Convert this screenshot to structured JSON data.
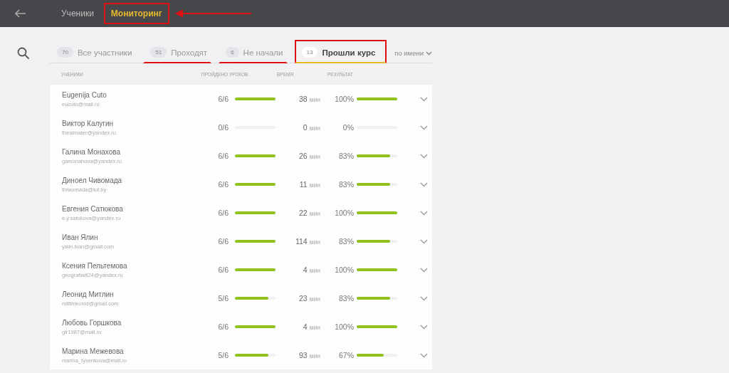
{
  "nav": [
    {
      "label": "Ученики",
      "selected": false,
      "framed": false
    },
    {
      "label": "Мониторинг",
      "selected": true,
      "framed": true
    }
  ],
  "filters": [
    {
      "count": "70",
      "label": "Все участники",
      "selected": false,
      "underlined": false,
      "framed": false
    },
    {
      "count": "51",
      "label": "Проходят",
      "selected": false,
      "underlined": true,
      "framed": false
    },
    {
      "count": "6",
      "label": "Не начали",
      "selected": false,
      "underlined": true,
      "framed": false
    },
    {
      "count": "13",
      "label": "Прошли курс",
      "selected": true,
      "underlined": false,
      "framed": true
    }
  ],
  "sort": {
    "label": "по имени"
  },
  "table": {
    "columns": [
      "УЧЕНИКИ",
      "ПРОЙДЕНО УРОКОВ",
      "ВРЕМЯ",
      "РЕЗУЛЬТАТ"
    ],
    "rows": [
      {
        "name": "Eugenija Cuto",
        "email": "eucuto@mail.ru",
        "lessons": "6/6",
        "lessons_progress": {
          "level": 1
        },
        "time": "38",
        "unit": "мин",
        "result": "100%",
        "result_progress": {
          "level": 1
        }
      },
      {
        "name": "Виктор Калугин",
        "email": "thealmater@yandex.ru",
        "lessons": "0/6",
        "lessons_progress": {
          "level": 0
        },
        "time": "0",
        "unit": "мин",
        "result": "0%",
        "result_progress": {
          "level": 0
        }
      },
      {
        "name": "Галина Монахова",
        "email": "gamonahova@yandex.ru",
        "lessons": "6/6",
        "lessons_progress": {
          "level": 1
        },
        "time": "26",
        "unit": "мин",
        "result": "83%",
        "result_progress": {
          "level": 0.83
        }
      },
      {
        "name": "Диноел Чивомада",
        "email": "thiwomada@tut.by",
        "lessons": "6/6",
        "lessons_progress": {
          "level": 1
        },
        "time": "11",
        "unit": "мин",
        "result": "83%",
        "result_progress": {
          "level": 0.83
        }
      },
      {
        "name": "Евгения Сатюкова",
        "email": "e.y.satukova@yandex.ru",
        "lessons": "6/6",
        "lessons_progress": {
          "level": 1
        },
        "time": "22",
        "unit": "мин",
        "result": "100%",
        "result_progress": {
          "level": 1
        }
      },
      {
        "name": "Иван Ялин",
        "email": "yalin.ivan@gmail.com",
        "lessons": "6/6",
        "lessons_progress": {
          "level": 1
        },
        "time": "114",
        "unit": "мин",
        "result": "83%",
        "result_progress": {
          "level": 0.83
        }
      },
      {
        "name": "Ксения Пельтемова",
        "email": "geografiaitl24@yandex.ru",
        "lessons": "6/6",
        "lessons_progress": {
          "level": 1
        },
        "time": "4",
        "unit": "мин",
        "result": "100%",
        "result_progress": {
          "level": 1
        }
      },
      {
        "name": "Леонид Митлин",
        "email": "mitlinleonid@gmail.com",
        "lessons": "5/6",
        "lessons_progress": {
          "level": 0.83
        },
        "time": "23",
        "unit": "мин",
        "result": "83%",
        "result_progress": {
          "level": 0.83
        }
      },
      {
        "name": "Любовь Горшкова",
        "email": "glr1987@mail.ru",
        "lessons": "6/6",
        "lessons_progress": {
          "level": 1
        },
        "time": "4",
        "unit": "мин",
        "result": "100%",
        "result_progress": {
          "level": 1
        }
      },
      {
        "name": "Марина Межевова",
        "email": "marina_tysenkova@mail.ru",
        "lessons": "5/6",
        "lessons_progress": {
          "level": 0.83
        },
        "time": "93",
        "unit": "мин",
        "result": "67%",
        "result_progress": {
          "level": 0.67
        }
      }
    ]
  }
}
